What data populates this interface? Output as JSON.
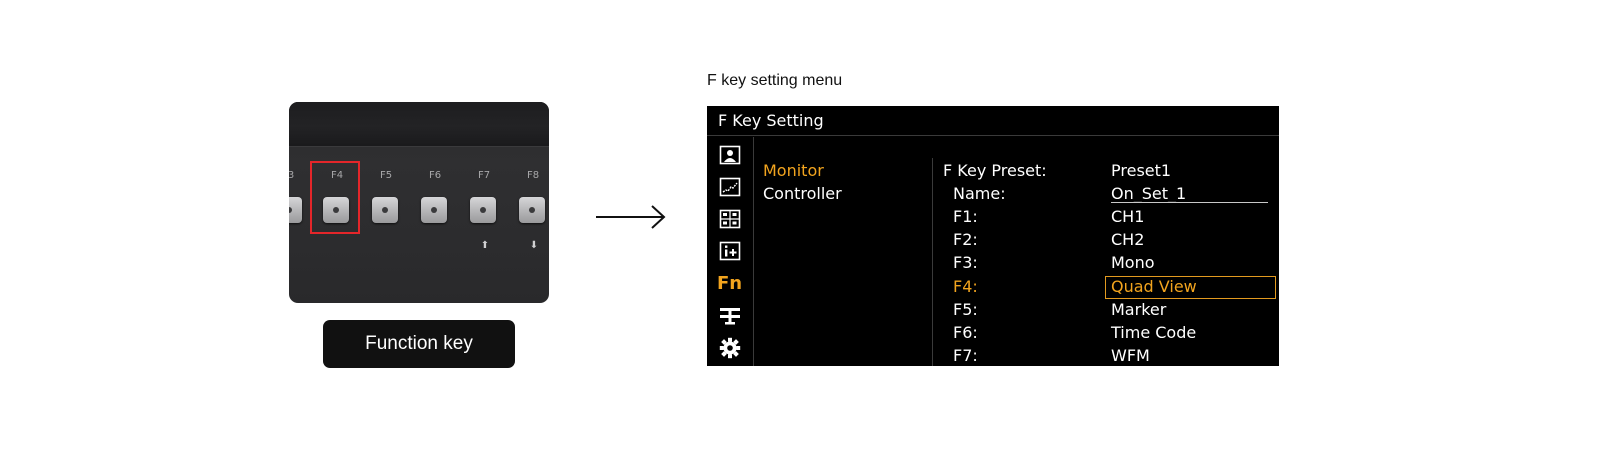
{
  "hardware": {
    "key_labels": [
      "3",
      "F4",
      "F5",
      "F6",
      "F7",
      "F8"
    ],
    "arrow_up_glyph": "⬆",
    "arrow_down_glyph": "⬇",
    "highlighted_key": "F4",
    "highlight_color": "#e4262a"
  },
  "caption": {
    "function_key": "Function key"
  },
  "menu_caption": "F key setting menu",
  "menu": {
    "title": "F Key Setting",
    "accent_color": "#f2a41e",
    "icons": [
      "person-icon",
      "waveform-icon",
      "quad-view-icon",
      "info-plus-icon",
      "fn-icon",
      "network-icon",
      "gear-icon"
    ],
    "fn_icon_text": "Fn",
    "categories": [
      {
        "label": "Monitor",
        "active": true
      },
      {
        "label": "Controller",
        "active": false
      }
    ],
    "params": [
      {
        "label": "F Key Preset:",
        "value": "Preset1"
      },
      {
        "label": "Name:",
        "value": "On_Set_1"
      },
      {
        "label": "F1:",
        "value": "CH1"
      },
      {
        "label": "F2:",
        "value": "CH2"
      },
      {
        "label": "F3:",
        "value": "Mono"
      },
      {
        "label": "F4:",
        "value": "Quad View",
        "active": true
      },
      {
        "label": "F5:",
        "value": "Marker"
      },
      {
        "label": "F6:",
        "value": "Time Code"
      },
      {
        "label": "F7:",
        "value": "WFM"
      }
    ]
  }
}
